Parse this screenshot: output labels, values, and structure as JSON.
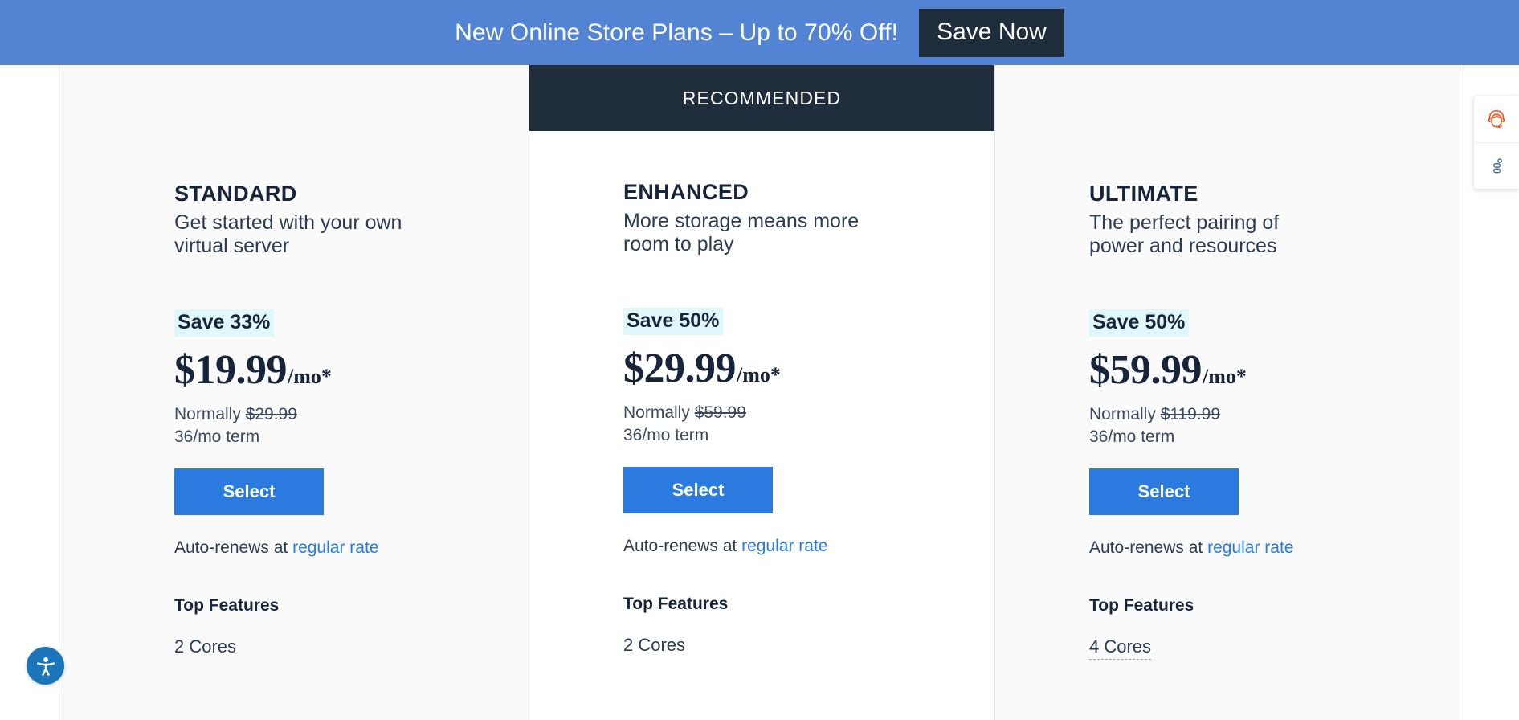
{
  "promo": {
    "message": "New Online Store Plans – Up to 70% Off!",
    "button_label": "Save Now",
    "background_color": "#5384d4",
    "button_color": "#1f2d3d"
  },
  "recommended_ribbon": {
    "label": "RECOMMENDED",
    "background_color": "#1f2d3d"
  },
  "common": {
    "normally_prefix": "Normally",
    "term": "36/mo term",
    "select_label": "Select",
    "renew_prefix": "Auto-renews at ",
    "renew_link": "regular rate",
    "features_title": "Top Features",
    "accent_color": "#2b7ae0",
    "save_badge_color": "#e0f7fb"
  },
  "plans": [
    {
      "name": "STANDARD",
      "tagline": "Get started with your own virtual server",
      "save_badge": "Save 33%",
      "price": "$19.99",
      "price_suffix": "/mo*",
      "normally_price": "$29.99",
      "term": "36/mo term",
      "select_label": "Select",
      "renew_prefix": "Auto-renews at ",
      "renew_link": "regular rate",
      "features_title": "Top Features",
      "features": [
        {
          "label": "2 Cores",
          "tooltip": false
        }
      ],
      "recommended": false
    },
    {
      "name": "ENHANCED",
      "tagline": "More storage means more room to play",
      "save_badge": "Save 50%",
      "price": "$29.99",
      "price_suffix": "/mo*",
      "normally_price": "$59.99",
      "term": "36/mo term",
      "select_label": "Select",
      "renew_prefix": "Auto-renews at ",
      "renew_link": "regular rate",
      "features_title": "Top Features",
      "features": [
        {
          "label": "2 Cores",
          "tooltip": false
        }
      ],
      "recommended": true
    },
    {
      "name": "ULTIMATE",
      "tagline": "The perfect pairing of power and resources",
      "save_badge": "Save 50%",
      "price": "$59.99",
      "price_suffix": "/mo*",
      "normally_price": "$119.99",
      "term": "36/mo term",
      "select_label": "Select",
      "renew_prefix": "Auto-renews at ",
      "renew_link": "regular rate",
      "features_title": "Top Features",
      "features": [
        {
          "label": "4 Cores",
          "tooltip": true
        }
      ],
      "recommended": false
    }
  ],
  "side_widget": {
    "buttons": [
      {
        "icon": "support-agent-icon",
        "color": "#e8581f"
      },
      {
        "icon": "chat-options-icon",
        "color": "#4a6f9c"
      }
    ]
  },
  "accessibility_widget": {
    "icon": "accessibility-icon",
    "color": "#1b75ba"
  }
}
